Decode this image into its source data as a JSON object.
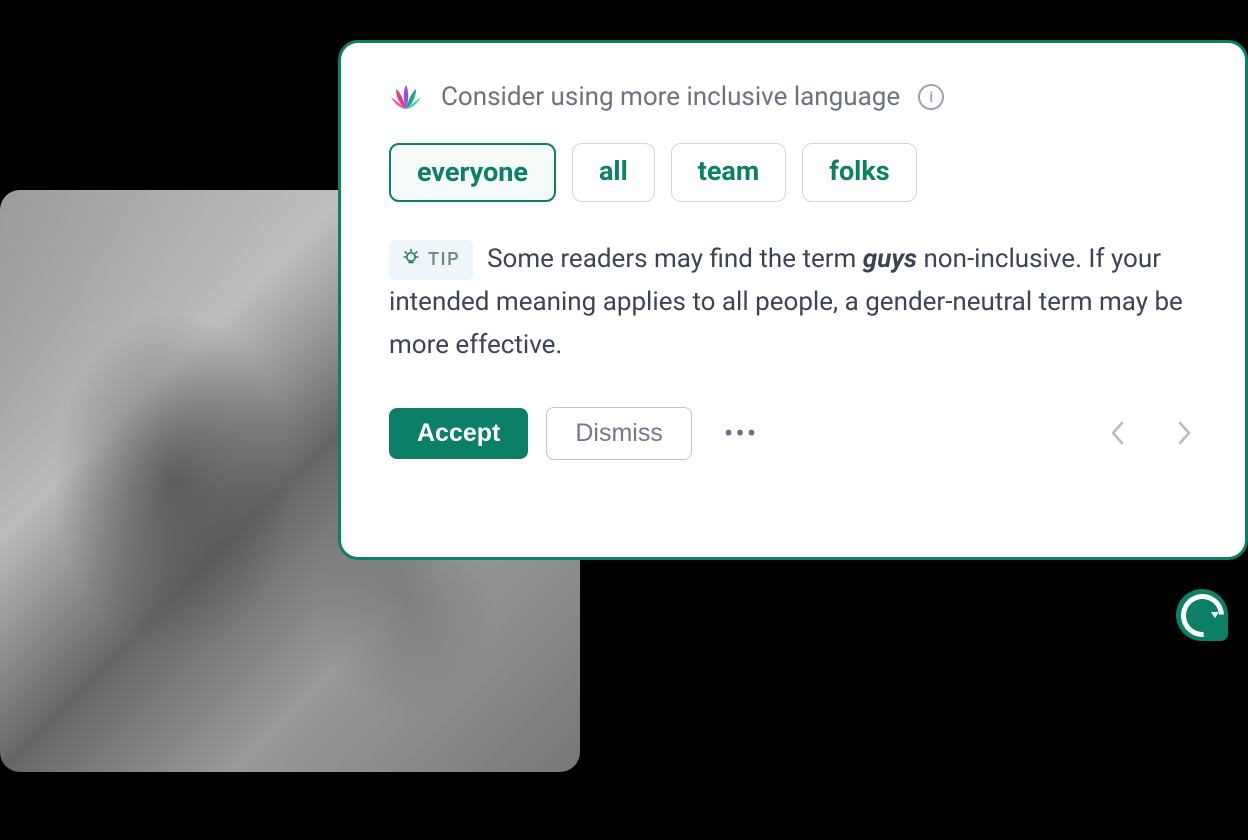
{
  "card": {
    "title": "Consider using more inclusive language",
    "suggestions": [
      {
        "label": "everyone",
        "selected": true
      },
      {
        "label": "all",
        "selected": false
      },
      {
        "label": "team",
        "selected": false
      },
      {
        "label": "folks",
        "selected": false
      }
    ],
    "tip": {
      "badge_label": "TIP",
      "text_before": "Some readers may find the term ",
      "term": "guys",
      "text_after": " non-inclusive. If your intended meaning applies to all people, a gender-neutral term may be more effective."
    },
    "actions": {
      "accept_label": "Accept",
      "dismiss_label": "Dismiss"
    }
  },
  "colors": {
    "brand_green": "#0b8066",
    "text_muted": "#6b7280",
    "text_body": "#3c4457"
  }
}
